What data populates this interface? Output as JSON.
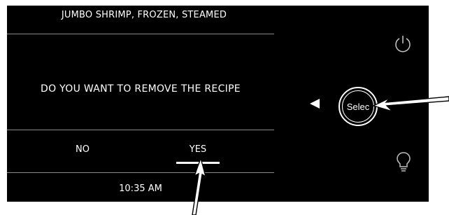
{
  "screen": {
    "title": "JUMBO SHRIMP, FROZEN, STEAMED",
    "question": "DO YOU WANT TO REMOVE THE RECIPE",
    "no_label": "NO",
    "yes_label": "YES",
    "selected_option": "YES",
    "time": "10:35 AM"
  },
  "controls": {
    "select_label": "Selec",
    "power_icon": "power-icon",
    "light_icon": "lightbulb-icon",
    "left_arrow_icon": "triangle-left-icon"
  },
  "colors": {
    "panel": "#000000",
    "text": "#ffffff",
    "divider": "#8a8a8a",
    "background": "#ffffff"
  }
}
